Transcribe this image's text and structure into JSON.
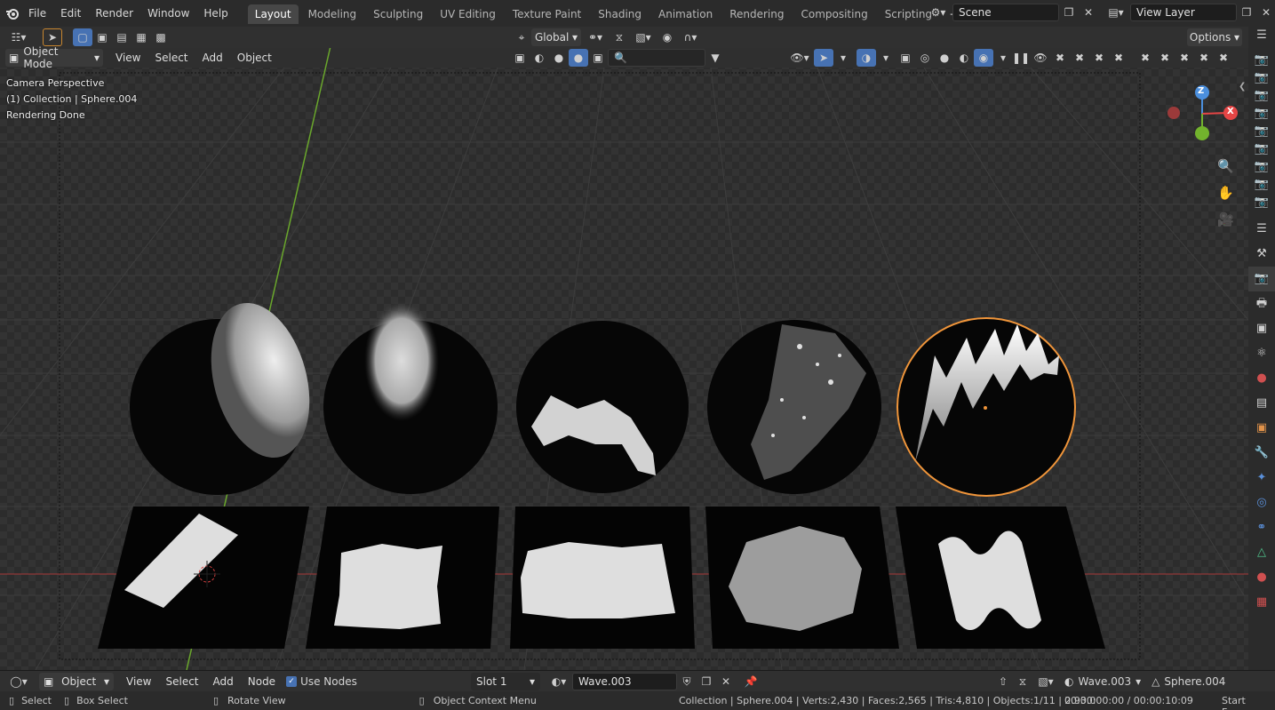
{
  "menu": {
    "items": [
      "File",
      "Edit",
      "Render",
      "Window",
      "Help"
    ]
  },
  "workspaces": {
    "tabs": [
      "Layout",
      "Modeling",
      "Sculpting",
      "UV Editing",
      "Texture Paint",
      "Shading",
      "Animation",
      "Rendering",
      "Compositing",
      "Scripting"
    ],
    "active": "Layout",
    "add_label": "+"
  },
  "scene": {
    "name": "Scene"
  },
  "view_layer": {
    "name": "View Layer"
  },
  "toolbar": {
    "transform_orientation": "Global",
    "options_label": "Options"
  },
  "viewport_header": {
    "mode": "Object Mode",
    "menus": [
      "View",
      "Select",
      "Add",
      "Object"
    ]
  },
  "overlay": {
    "line1": "Camera Perspective",
    "line2": "(1) Collection | Sphere.004",
    "line3": "Rendering Done"
  },
  "gizmo": {
    "z": "Z",
    "x": "X"
  },
  "node_header": {
    "editor_type": "Object",
    "menus": [
      "View",
      "Select",
      "Add",
      "Node"
    ],
    "use_nodes": "Use Nodes",
    "slot": "Slot 1",
    "material": "Wave.003",
    "material2": "Wave.003",
    "object": "Sphere.004"
  },
  "status": {
    "select": "Select",
    "box_select": "Box Select",
    "rotate_view": "Rotate View",
    "context_menu": "Object Context Menu",
    "stats": "Collection | Sphere.004 | Verts:2,430 | Faces:2,565 | Tris:4,810 | Objects:1/11 | 2.93.0",
    "time": "00:00:00:00 / 00:00:10:09",
    "start_frame": "Start Frame"
  },
  "colors": {
    "accent": "#4772b3",
    "selection_outline": "#f0953a",
    "x_axis": "#e54545",
    "y_axis": "#72b32d",
    "z_axis": "#4b8fdd"
  }
}
